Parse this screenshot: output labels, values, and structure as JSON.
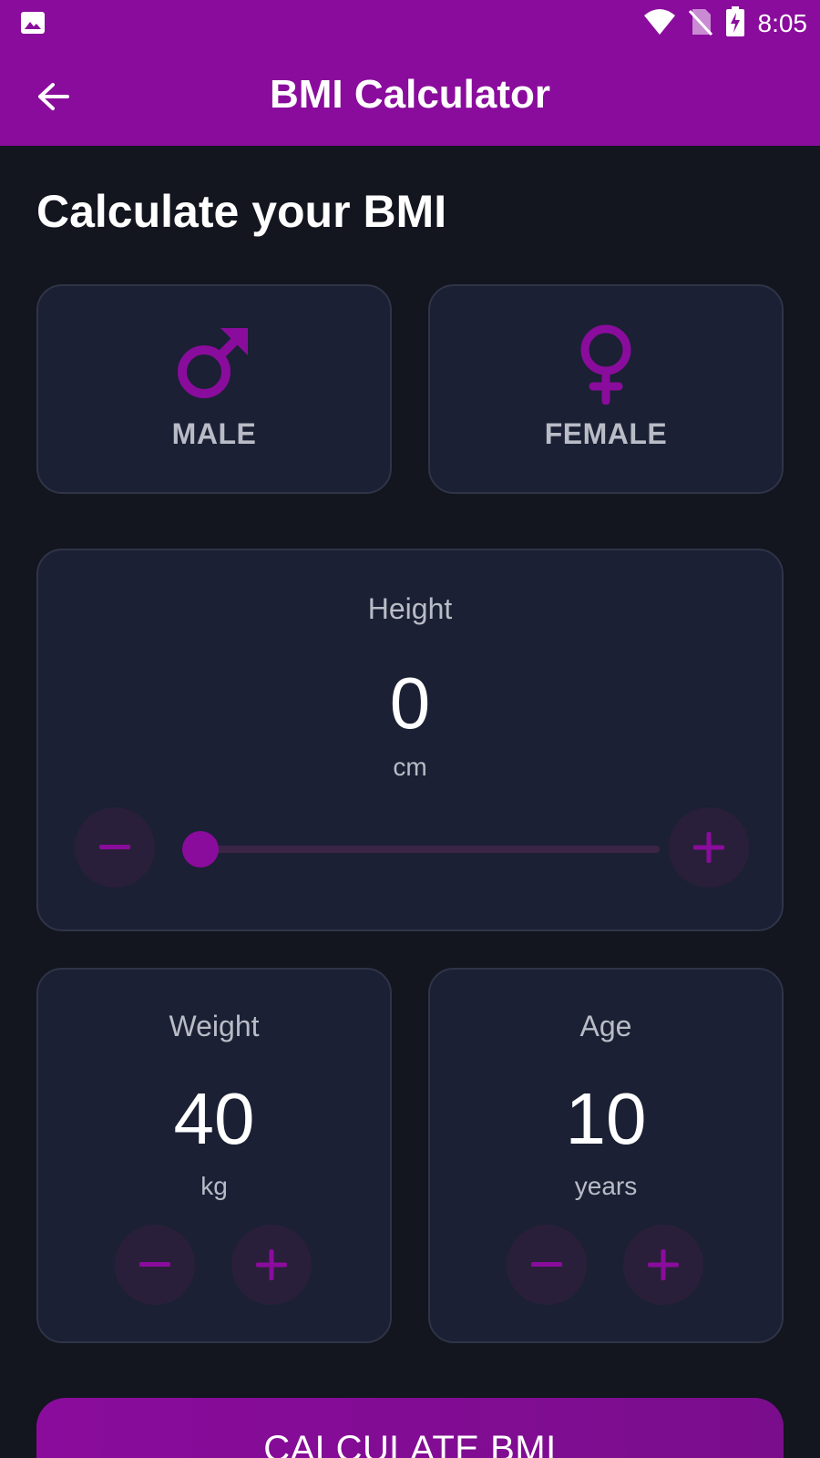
{
  "status_bar": {
    "time": "8:05"
  },
  "app_bar": {
    "title": "BMI Calculator"
  },
  "page": {
    "heading": "Calculate your BMI"
  },
  "gender": {
    "male_label": "MALE",
    "female_label": "FEMALE",
    "selected": "none"
  },
  "height": {
    "label": "Height",
    "value": "0",
    "unit": "cm",
    "slider_fraction": 0
  },
  "weight": {
    "label": "Weight",
    "value": "40",
    "unit": "kg"
  },
  "age": {
    "label": "Age",
    "value": "10",
    "unit": "years"
  },
  "actions": {
    "calculate_label": "CALCULATE BMI"
  },
  "colors": {
    "accent": "#8a0c9c",
    "background": "#13151f",
    "card": "#1b2034",
    "card_border": "#2f3447",
    "muted_text": "#b9bcc6",
    "button_bg": "#2a1f3a"
  }
}
